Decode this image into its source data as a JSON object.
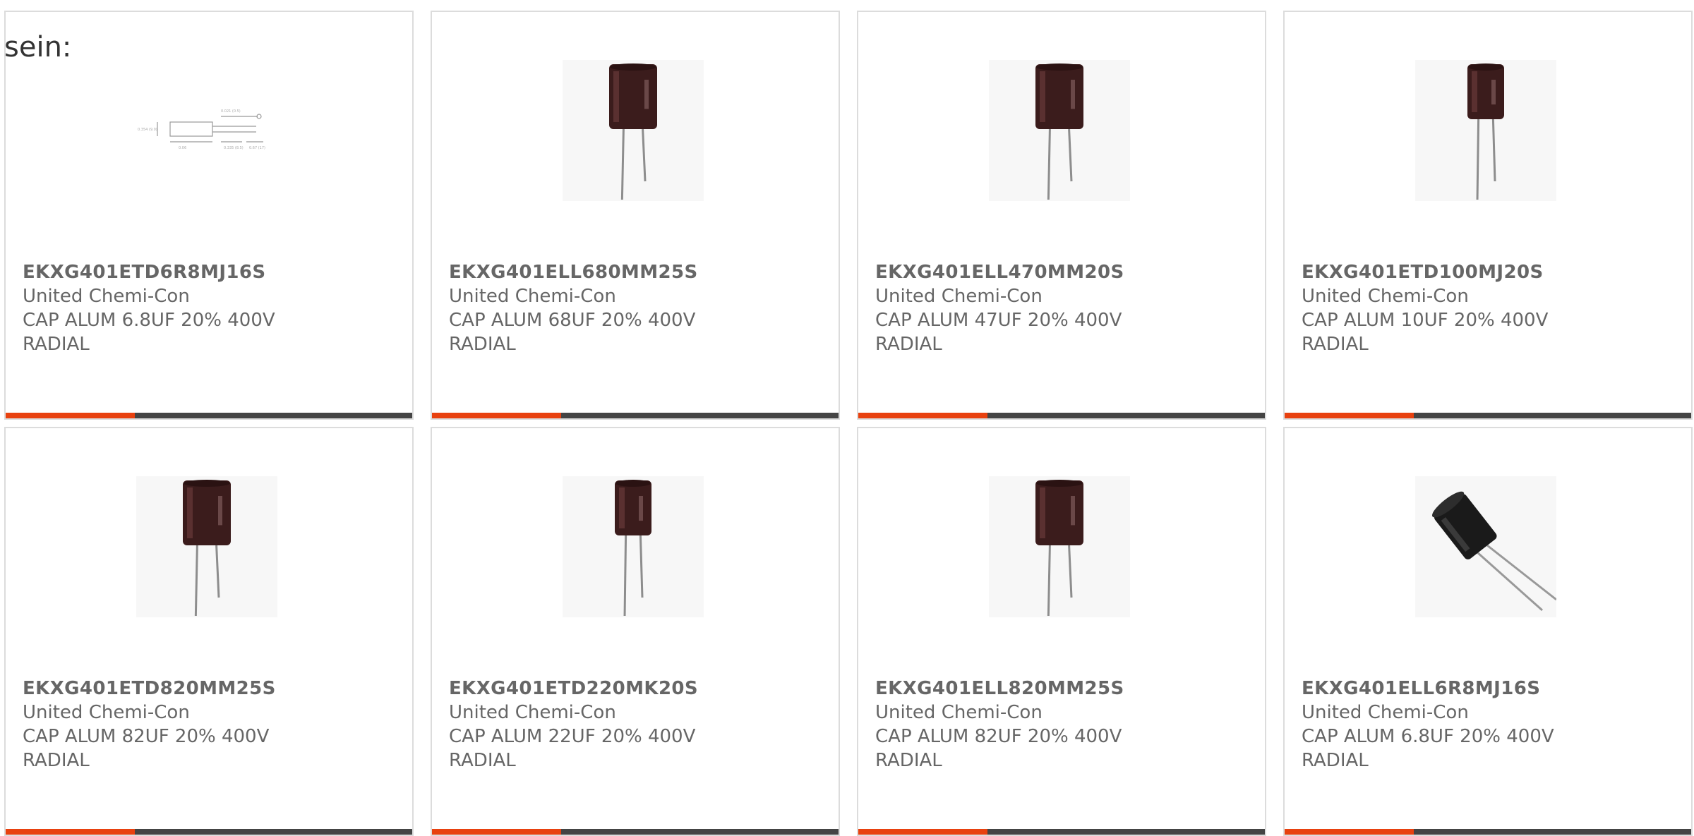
{
  "heading": "sein:",
  "accent_color": "#e8410f",
  "bar_color": "#444444",
  "products": [
    {
      "part_number": "EKXG401ETD6R8MJ16S",
      "manufacturer": "United Chemi-Con",
      "desc1": "CAP ALUM 6.8UF 20% 400V",
      "desc2": "RADIAL",
      "image": "dimension-drawing"
    },
    {
      "part_number": "EKXG401ELL680MM25S",
      "manufacturer": "United Chemi-Con",
      "desc1": "CAP ALUM 68UF 20% 400V",
      "desc2": "RADIAL",
      "image": "radial-capacitor-large"
    },
    {
      "part_number": "EKXG401ELL470MM20S",
      "manufacturer": "United Chemi-Con",
      "desc1": "CAP ALUM 47UF 20% 400V",
      "desc2": "RADIAL",
      "image": "radial-capacitor-large"
    },
    {
      "part_number": "EKXG401ETD100MJ20S",
      "manufacturer": "United Chemi-Con",
      "desc1": "CAP ALUM 10UF 20% 400V",
      "desc2": "RADIAL",
      "image": "radial-capacitor-small"
    },
    {
      "part_number": "EKXG401ETD820MM25S",
      "manufacturer": "United Chemi-Con",
      "desc1": "CAP ALUM 82UF 20% 400V",
      "desc2": "RADIAL",
      "image": "radial-capacitor-large"
    },
    {
      "part_number": "EKXG401ETD220MK20S",
      "manufacturer": "United Chemi-Con",
      "desc1": "CAP ALUM 22UF 20% 400V",
      "desc2": "RADIAL",
      "image": "radial-capacitor-small"
    },
    {
      "part_number": "EKXG401ELL820MM25S",
      "manufacturer": "United Chemi-Con",
      "desc1": "CAP ALUM 82UF 20% 400V",
      "desc2": "RADIAL",
      "image": "radial-capacitor-large"
    },
    {
      "part_number": "EKXG401ELL6R8MJ16S",
      "manufacturer": "United Chemi-Con",
      "desc1": "CAP ALUM 6.8UF 20% 400V",
      "desc2": "RADIAL",
      "image": "radial-capacitor-tilted"
    }
  ]
}
